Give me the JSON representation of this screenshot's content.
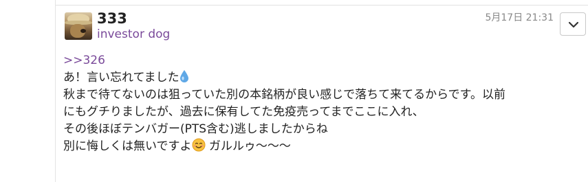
{
  "post": {
    "username": "333",
    "user_id": "investor dog",
    "timestamp": "5月17日 21:31",
    "avatar_icon": "dog-avatar-icon",
    "menu_icon": "chevron-down-icon",
    "reply_link": ">>326",
    "lines": [
      "あ！言い忘れてました",
      "秋まで待てないのは狙っていた別の本銘柄が良い感じで落ちて来てるからです。以前",
      "にもグチりましたが、過去に保有してた免疫売ってまでここに入れ、",
      "その後ほぼテンバガー(PTS含む)逃しましたからね",
      "別に悔しくは無いですよ",
      " ガルルゥ〜〜〜"
    ],
    "emoji": {
      "droplet": "water-droplet-icon",
      "smile": "smiling-face-icon"
    }
  },
  "colors": {
    "link": "#7a4a9a",
    "text": "#222222",
    "timestamp": "#888888"
  }
}
